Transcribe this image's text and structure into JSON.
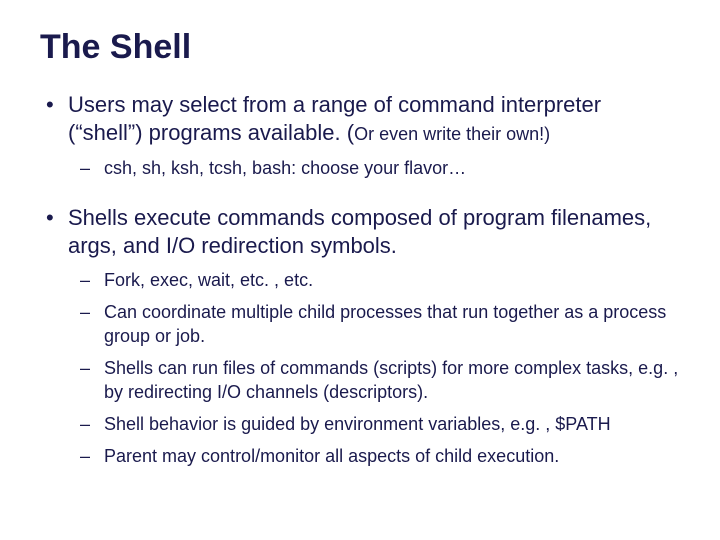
{
  "title": "The Shell",
  "items": [
    {
      "text_main": "Users may select from a range of command interpreter (“shell”) programs available. (",
      "text_small": "Or even write their own!)",
      "sub": [
        "csh, sh, ksh, tcsh, bash: choose your flavor…"
      ]
    },
    {
      "text_main": "Shells execute commands composed of program filenames, args, and I/O redirection symbols.",
      "text_small": "",
      "sub": [
        "Fork, exec, wait, etc. , etc.",
        "Can coordinate multiple child processes that run together as a process group or job.",
        "Shells can run files of commands (scripts) for more complex tasks, e.g. , by redirecting I/O channels (descriptors).",
        "Shell behavior is guided by environment variables, e.g. , $PATH",
        "Parent may control/monitor all aspects of child execution."
      ]
    }
  ]
}
